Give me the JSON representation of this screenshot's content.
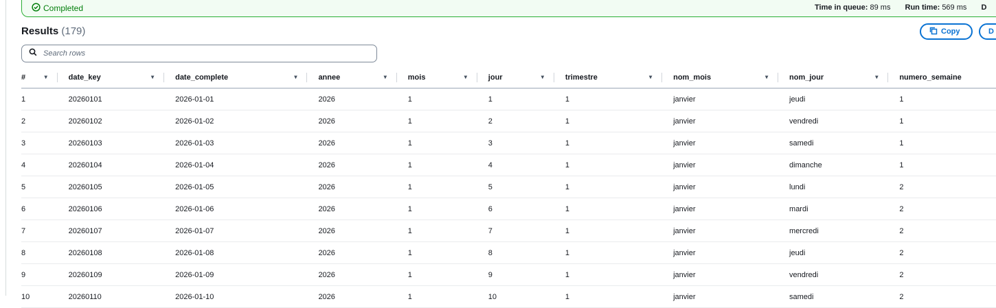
{
  "status": {
    "label": "Completed",
    "time_in_queue_label": "Time in queue:",
    "time_in_queue_value": "89 ms",
    "run_time_label": "Run time:",
    "run_time_value": "569 ms",
    "truncated_label": "D"
  },
  "results": {
    "title": "Results",
    "count": "(179)"
  },
  "buttons": {
    "copy": "Copy",
    "download_truncated": "D"
  },
  "search": {
    "placeholder": "Search rows"
  },
  "table": {
    "columns": [
      "#",
      "date_key",
      "date_complete",
      "annee",
      "mois",
      "jour",
      "trimestre",
      "nom_mois",
      "nom_jour",
      "numero_semaine"
    ],
    "rows": [
      [
        "1",
        "20260101",
        "2026-01-01",
        "2026",
        "1",
        "1",
        "1",
        "janvier",
        "jeudi",
        "1"
      ],
      [
        "2",
        "20260102",
        "2026-01-02",
        "2026",
        "1",
        "2",
        "1",
        "janvier",
        "vendredi",
        "1"
      ],
      [
        "3",
        "20260103",
        "2026-01-03",
        "2026",
        "1",
        "3",
        "1",
        "janvier",
        "samedi",
        "1"
      ],
      [
        "4",
        "20260104",
        "2026-01-04",
        "2026",
        "1",
        "4",
        "1",
        "janvier",
        "dimanche",
        "1"
      ],
      [
        "5",
        "20260105",
        "2026-01-05",
        "2026",
        "1",
        "5",
        "1",
        "janvier",
        "lundi",
        "2"
      ],
      [
        "6",
        "20260106",
        "2026-01-06",
        "2026",
        "1",
        "6",
        "1",
        "janvier",
        "mardi",
        "2"
      ],
      [
        "7",
        "20260107",
        "2026-01-07",
        "2026",
        "1",
        "7",
        "1",
        "janvier",
        "mercredi",
        "2"
      ],
      [
        "8",
        "20260108",
        "2026-01-08",
        "2026",
        "1",
        "8",
        "1",
        "janvier",
        "jeudi",
        "2"
      ],
      [
        "9",
        "20260109",
        "2026-01-09",
        "2026",
        "1",
        "9",
        "1",
        "janvier",
        "vendredi",
        "2"
      ],
      [
        "10",
        "20260110",
        "2026-01-10",
        "2026",
        "1",
        "10",
        "1",
        "janvier",
        "samedi",
        "2"
      ]
    ]
  },
  "colors": {
    "success": "#037f0c",
    "success_bg": "#f2fcf3",
    "accent": "#0972d3"
  },
  "icons": {
    "status": "check-circle-icon",
    "search": "search-icon",
    "copy": "copy-icon",
    "sort": "caret-down-icon"
  }
}
